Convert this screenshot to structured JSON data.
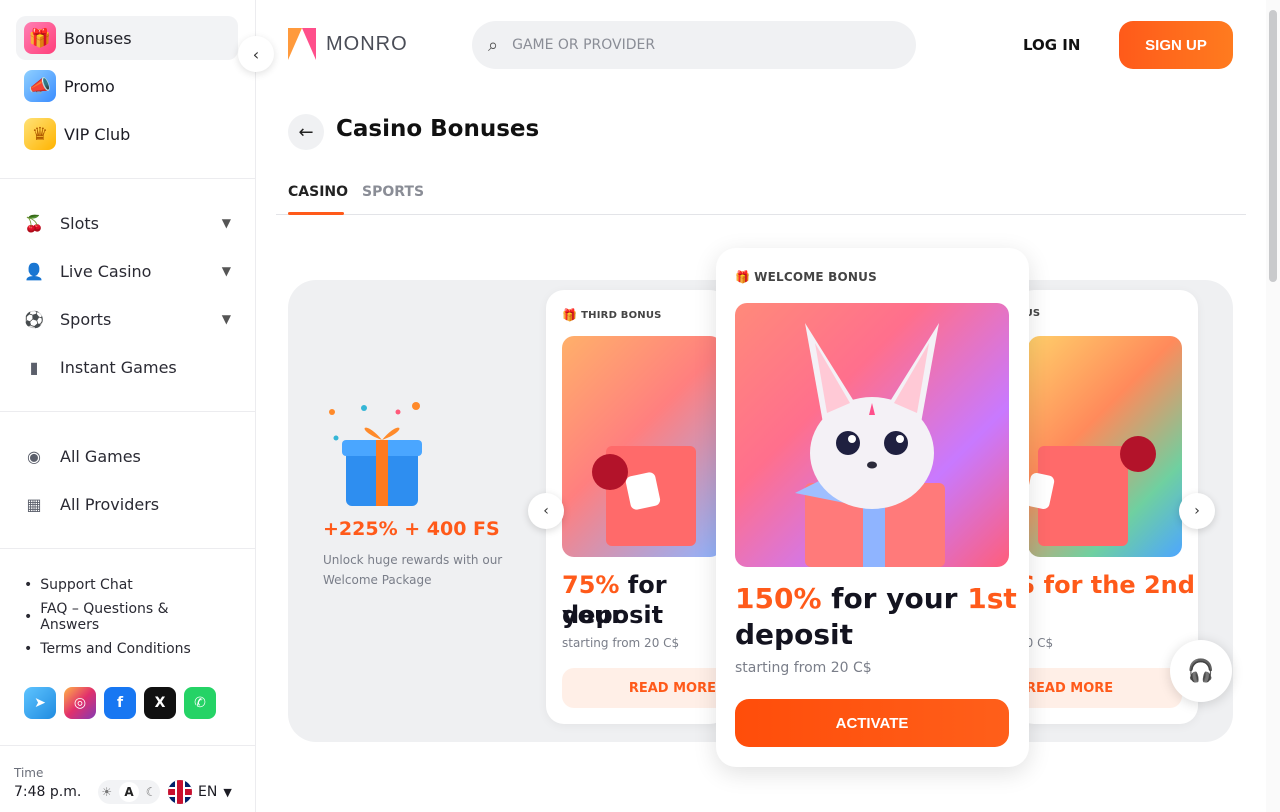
{
  "sidebar": {
    "top_items": [
      {
        "label": "Bonuses",
        "icon": "gift-icon",
        "active": true
      },
      {
        "label": "Promo",
        "icon": "megaphone-icon"
      },
      {
        "label": "VIP Club",
        "icon": "crown-icon"
      }
    ],
    "nav_items": [
      {
        "label": "Slots",
        "icon": "cherries-icon"
      },
      {
        "label": "Live Casino",
        "icon": "dealer-icon"
      },
      {
        "label": "Sports",
        "icon": "soccer-ball-icon"
      },
      {
        "label": "Instant Games",
        "icon": "bar-chart-icon"
      }
    ],
    "game_items": [
      {
        "label": "All Games",
        "icon": "compass-icon"
      },
      {
        "label": "All Providers",
        "icon": "grid-icon"
      }
    ],
    "links": [
      "Support Chat",
      "FAQ – Questions & Answers",
      "Terms and Conditions"
    ],
    "socials": [
      "telegram-icon",
      "instagram-icon",
      "facebook-icon",
      "x-icon",
      "whatsapp-icon"
    ],
    "time_label": "Time",
    "time_value": "7:48 p.m.",
    "theme_active": "A",
    "language": "EN"
  },
  "header": {
    "logo_text": "MONRO",
    "search_placeholder": "GAME OR PROVIDER",
    "login_label": "LOG IN",
    "signup_label": "SIGN UP"
  },
  "page": {
    "title": "Casino Bonuses",
    "tabs": [
      {
        "label": "CASINO",
        "active": true
      },
      {
        "label": "SPORTS",
        "active": false
      }
    ]
  },
  "promo": {
    "title": "+225% + 400 FS",
    "subtitle": "Unlock huge rewards with our Welcome Package"
  },
  "cards": {
    "left": {
      "label": "THIRD BONUS",
      "percent": "75%",
      "line1_rest": " for your",
      "line2": "deposit",
      "starting": "starting from 20 C$",
      "button": "READ MORE"
    },
    "main": {
      "label": "WELCOME BONUS",
      "percent": "150%",
      "mid": " for your ",
      "ordinal": "1st",
      "line2": "deposit",
      "starting": "starting from 20 C$",
      "button": "ACTIVATE"
    },
    "right": {
      "label": "NUS",
      "line1_pre": "S for the ",
      "ordinal": "2nd",
      "line2": "t",
      "starting": "20 C$",
      "button": "READ MORE"
    }
  },
  "colors": {
    "accent": "#ff5a1a",
    "text": "#13131f",
    "muted": "#7a7e89"
  }
}
